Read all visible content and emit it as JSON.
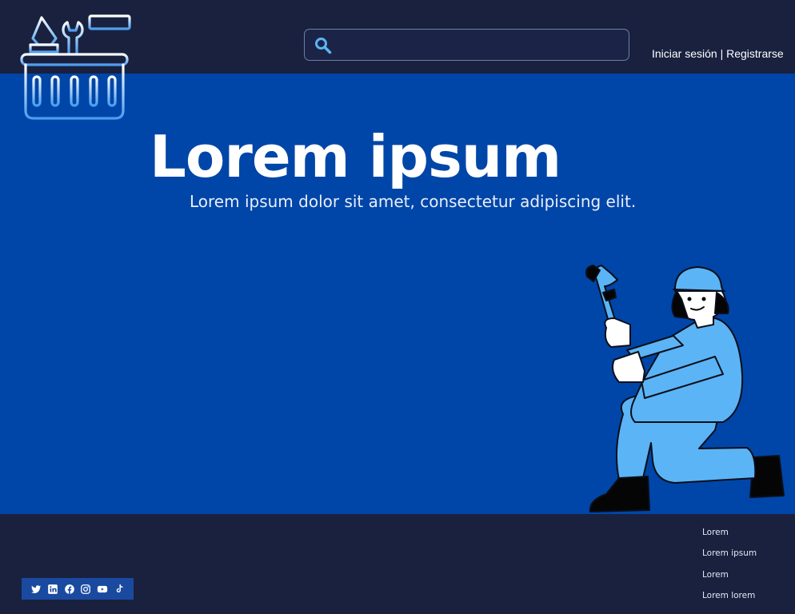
{
  "header": {
    "search": {
      "placeholder": ""
    },
    "auth": {
      "login": "Iniciar sesión",
      "separator": "|",
      "register": "Registrarse"
    }
  },
  "hero": {
    "title": "Lorem ipsum",
    "subtitle": "Lorem ipsum dolor sit amet, consectetur adipiscing elit."
  },
  "footer": {
    "links": [
      "Lorem",
      "Lorem ipsum",
      "Lorem",
      "Lorem lorem"
    ],
    "social": [
      "twitter-icon",
      "linkedin-icon",
      "facebook-icon",
      "instagram-icon",
      "youtube-icon",
      "tiktok-icon"
    ]
  },
  "colors": {
    "header_bg": "#19213f",
    "hero_bg": "#0046a8",
    "accent_light_blue": "#5bb4f5",
    "social_bar": "#1a4aa0"
  }
}
